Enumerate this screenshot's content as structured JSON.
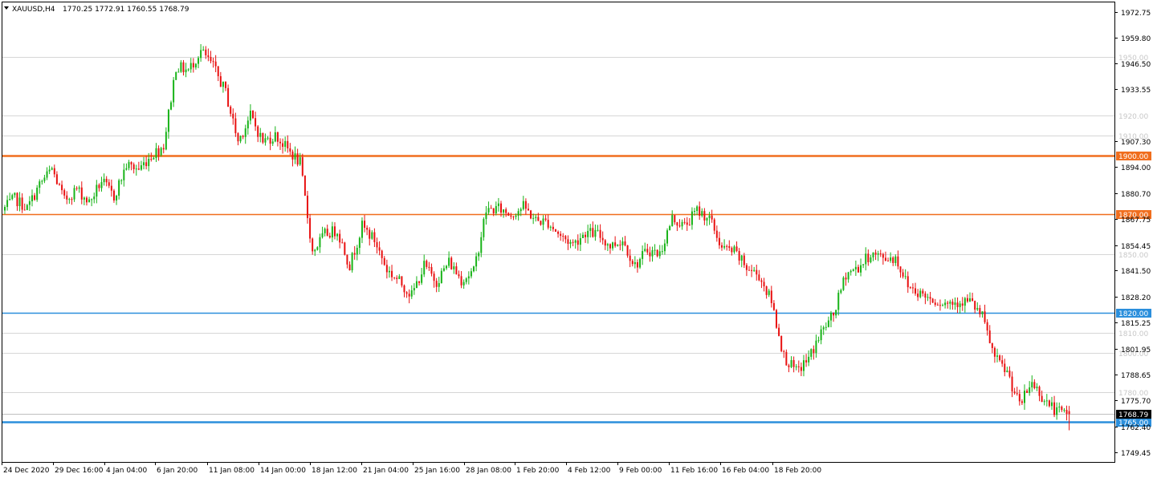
{
  "header": {
    "symbol_timeframe": "XAUUSD,H4",
    "ohlc": "1770.25 1772.91 1760.55 1768.79"
  },
  "colors": {
    "background": "#ffffff",
    "bull": "#18b318",
    "bear": "#e81010",
    "grid": "#d6d6d6",
    "axis": "#000000",
    "orange": "#f06e1e",
    "blue": "#2b8fdc",
    "price_tag_bg": "#000000",
    "faint_label": "#c8c8c8"
  },
  "chart_data": {
    "type": "candlestick",
    "title": "XAUUSD,H4",
    "y_range": [
      1744.5,
      1977.5
    ],
    "y_ticks": [
      {
        "v": 1972.75,
        "label": "1972.75"
      },
      {
        "v": 1959.8,
        "label": "1959.80"
      },
      {
        "v": 1946.5,
        "label": "1946.50"
      },
      {
        "v": 1933.55,
        "label": "1933.55"
      },
      {
        "v": 1907.3,
        "label": "1907.30"
      },
      {
        "v": 1894.0,
        "label": "1894.00"
      },
      {
        "v": 1880.7,
        "label": "1880.70"
      },
      {
        "v": 1867.75,
        "label": "1867.75"
      },
      {
        "v": 1854.45,
        "label": "1854.45"
      },
      {
        "v": 1841.5,
        "label": "1841.50"
      },
      {
        "v": 1828.2,
        "label": "1828.20"
      },
      {
        "v": 1815.25,
        "label": "1815.25"
      },
      {
        "v": 1801.95,
        "label": "1801.95"
      },
      {
        "v": 1788.65,
        "label": "1788.65"
      },
      {
        "v": 1775.7,
        "label": "1775.70"
      },
      {
        "v": 1762.4,
        "label": "1762.40"
      },
      {
        "v": 1749.45,
        "label": "1749.45"
      }
    ],
    "x_labels": [
      "24 Dec 2020",
      "29 Dec 16:00",
      "4 Jan 04:00",
      "6 Jan 20:00",
      "11 Jan 08:00",
      "14 Jan 00:00",
      "18 Jan 12:00",
      "21 Jan 04:00",
      "25 Jan 16:00",
      "28 Jan 08:00",
      "1 Feb 20:00",
      "4 Feb 12:00",
      "9 Feb 00:00",
      "11 Feb 16:00",
      "16 Feb 04:00",
      "18 Feb 20:00"
    ],
    "faint_levels": [
      {
        "v": 1950,
        "label": "1950.00"
      },
      {
        "v": 1920,
        "label": "1920.00"
      },
      {
        "v": 1910,
        "label": "1910.00"
      },
      {
        "v": 1850,
        "label": "1850.00"
      },
      {
        "v": 1810,
        "label": "1810.00"
      },
      {
        "v": 1800,
        "label": "1800.00"
      },
      {
        "v": 1780,
        "label": "1780.00"
      }
    ],
    "levels": [
      {
        "v": 1900,
        "label": "1900.00",
        "color": "orange",
        "width": 2.5
      },
      {
        "v": 1870,
        "label": "1870.00",
        "color": "orange",
        "width": 1.5
      },
      {
        "v": 1820,
        "label": "1820.00",
        "color": "blue",
        "width": 1.5
      },
      {
        "v": 1765,
        "label": "1765.00",
        "color": "blue",
        "width": 2.5
      }
    ],
    "current_price": {
      "v": 1768.79,
      "label": "1768.79"
    },
    "path": [
      1872,
      1878,
      1873,
      1885,
      1893,
      1877,
      1883,
      1876,
      1887,
      1879,
      1895,
      1893,
      1900,
      1905,
      1945,
      1943,
      1953,
      1945,
      1932,
      1907,
      1920,
      1907,
      1910,
      1903,
      1896,
      1851,
      1860,
      1862,
      1844,
      1864,
      1857,
      1842,
      1836,
      1829,
      1844,
      1836,
      1846,
      1837,
      1841,
      1872,
      1873,
      1870,
      1874,
      1867,
      1866,
      1859,
      1855,
      1861,
      1860,
      1854,
      1857,
      1844,
      1852,
      1850,
      1868,
      1864,
      1872,
      1868,
      1853,
      1851,
      1843,
      1839,
      1826,
      1798,
      1790,
      1797,
      1810,
      1819,
      1840,
      1843,
      1850,
      1848,
      1848,
      1834,
      1830,
      1827,
      1825,
      1826,
      1826,
      1818,
      1797,
      1790,
      1773,
      1785,
      1776,
      1770,
      1768.79
    ]
  }
}
